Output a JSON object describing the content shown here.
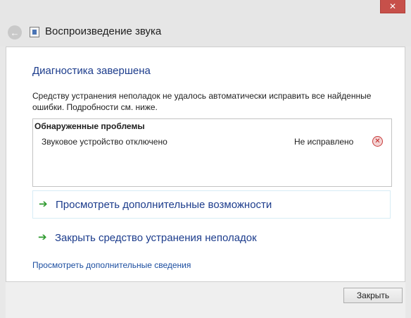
{
  "window": {
    "title": "Воспроизведение звука",
    "close_glyph": "✕",
    "back_glyph": "←"
  },
  "main": {
    "heading": "Диагностика завершена",
    "description": "Средству устранения неполадок не удалось автоматически исправить все найденные ошибки. Подробности см. ниже.",
    "problems": {
      "header": "Обнаруженные проблемы",
      "items": [
        {
          "name": "Звуковое устройство отключено",
          "status": "Не исправлено",
          "status_icon": "error-icon"
        }
      ]
    },
    "actions": [
      {
        "label": "Просмотреть дополнительные возможности",
        "icon": "green-arrow-icon"
      },
      {
        "label": "Закрыть средство устранения неполадок",
        "icon": "green-arrow-icon"
      }
    ],
    "details_link": "Просмотреть дополнительные сведения"
  },
  "footer": {
    "close_label": "Закрыть"
  },
  "colors": {
    "accent": "#1c3c8c",
    "link": "#1c4ea0",
    "arrow": "#2e9a2e",
    "error": "#c83c3c",
    "close_button": "#c7504a"
  }
}
